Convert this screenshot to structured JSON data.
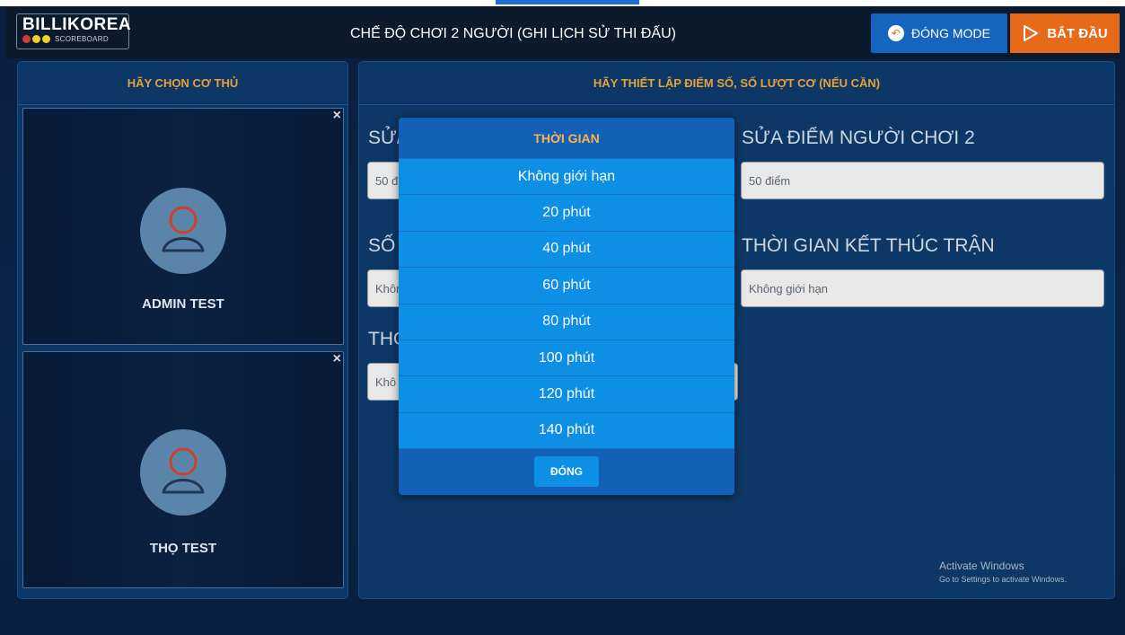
{
  "header": {
    "logo_text": "BILLIKOREA",
    "logo_sub": "SCOREBOARD",
    "title": "CHẾ ĐỘ CHƠI 2 NGƯỜI (GHI LỊCH SỬ THI ĐẤU)",
    "close_mode_label": "ĐÓNG MODE",
    "start_label": "BẮT ĐẦU"
  },
  "left_panel": {
    "title": "HÃY CHỌN CƠ THỦ",
    "players": [
      {
        "name": "ADMIN TEST",
        "close": "×"
      },
      {
        "name": "THỌ TEST",
        "close": "×"
      }
    ]
  },
  "right_panel": {
    "title": "HÃY THIẾT LẬP ĐIỂM SỐ, SỐ LƯỢT CƠ (NẾU CẦN)",
    "fields": {
      "score1_label_partial": "SỬ/",
      "score1_value_partial": "50 đ",
      "turns_label_partial": "SỐ",
      "turns_value_partial": "Khôn",
      "time_label_partial": "THO",
      "time_value_partial": "Khô",
      "score2_label": "SỬA ĐIỂM NGƯỜI CHƠI 2",
      "score2_value": "50 điểm",
      "end_time_label": "THỜI GIAN KẾT THÚC TRẬN",
      "end_time_value": "Không giới hạn"
    }
  },
  "modal": {
    "title": "THỜI GIAN",
    "options": [
      "Không giới hạn",
      "20 phút",
      "40 phút",
      "60 phút",
      "80 phút",
      "100 phút",
      "120 phút",
      "140 phút"
    ],
    "close_label": "ĐÓNG"
  },
  "watermark": {
    "line1": "Activate Windows",
    "line2": "Go to Settings to activate Windows."
  },
  "colors": {
    "accent_orange": "#e66a1a",
    "heading_gold": "#e5a23a",
    "modal_option_blue": "#0d8fe6",
    "panel_blue": "#0d3766"
  }
}
